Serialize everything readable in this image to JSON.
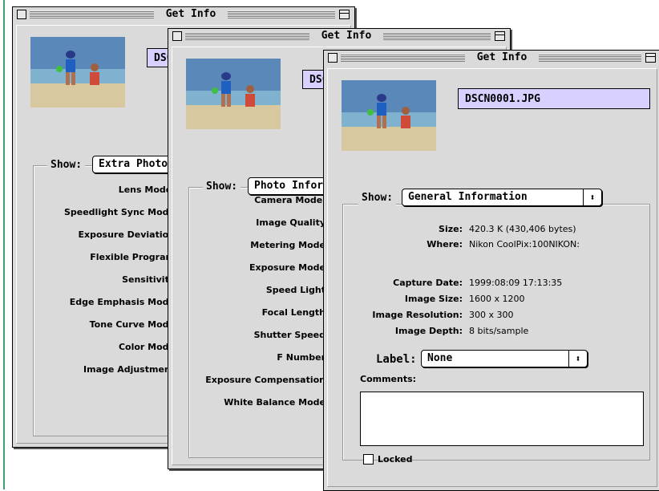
{
  "windows": [
    {
      "title": "Get Info",
      "filename": "DSC",
      "show_label": "Show:",
      "show_value": "Extra Photo",
      "fields": [
        "Lens Model",
        "Speedlight Sync Mode",
        "Exposure Deviation",
        "Flexible Program",
        "Sensitivity",
        "Edge Emphasis Mode",
        "Tone Curve Mode",
        "Color Mode",
        "Image Adjustment"
      ]
    },
    {
      "title": "Get Info",
      "filename": "DSC",
      "show_label": "Show:",
      "show_value": "Photo Infor",
      "fields": [
        "Camera Model",
        "Image Quality",
        "Metering Mode",
        "Exposure Mode",
        "Speed Light",
        "Focal Length",
        "Shutter Speed",
        "F Number",
        "Exposure Compensation",
        "White Balance Mode"
      ]
    },
    {
      "title": "Get Info",
      "filename": "DSCN0001.JPG",
      "show_label": "Show:",
      "show_value": "General Information",
      "info": [
        {
          "label": "Size:",
          "value": "420.3 K (430,406 bytes)"
        },
        {
          "label": "Where:",
          "value": "Nikon CoolPix:100NIKON:"
        }
      ],
      "capture": [
        {
          "label": "Capture Date:",
          "value": "1999:08:09 17:13:35"
        },
        {
          "label": "Image Size:",
          "value": "1600 x 1200"
        },
        {
          "label": "Image Resolution:",
          "value": "300 x 300"
        },
        {
          "label": "Image Depth:",
          "value": "8 bits/sample"
        }
      ],
      "label_label": "Label:",
      "label_value": "None",
      "comments_label": "Comments:",
      "comments_value": "",
      "locked_label": "Locked",
      "locked_checked": false
    }
  ],
  "icons": {
    "popup_arrows": "⬍"
  }
}
